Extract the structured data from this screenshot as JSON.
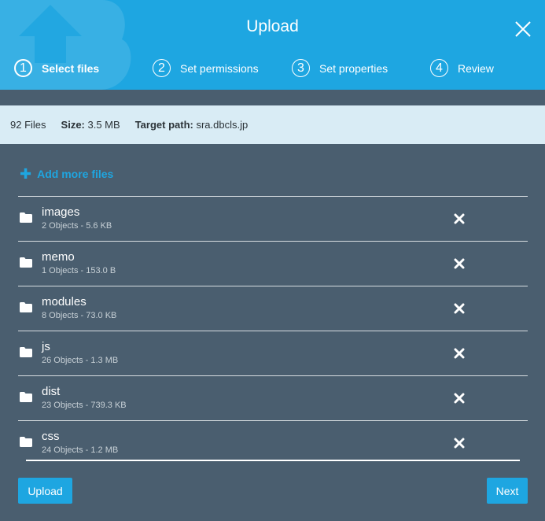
{
  "header": {
    "title": "Upload",
    "steps": [
      {
        "number": "1",
        "label": "Select files",
        "active": true
      },
      {
        "number": "2",
        "label": "Set permissions",
        "active": false
      },
      {
        "number": "3",
        "label": "Set properties",
        "active": false
      },
      {
        "number": "4",
        "label": "Review",
        "active": false
      }
    ]
  },
  "summary": {
    "files": "92 Files",
    "size_label": "Size:",
    "size_value": "3.5 MB",
    "target_label": "Target path:",
    "target_value": "sra.dbcls.jp"
  },
  "add_more_label": "Add more files",
  "folders": [
    {
      "name": "images",
      "meta": "2 Objects - 5.6 KB"
    },
    {
      "name": "memo",
      "meta": "1 Objects - 153.0 B"
    },
    {
      "name": "modules",
      "meta": "8 Objects - 73.0 KB"
    },
    {
      "name": "js",
      "meta": "26 Objects - 1.3 MB"
    },
    {
      "name": "dist",
      "meta": "23 Objects - 739.3 KB"
    },
    {
      "name": "css",
      "meta": "24 Objects - 1.2 MB"
    }
  ],
  "buttons": {
    "upload": "Upload",
    "next": "Next"
  },
  "icons": {
    "folder": "folder-icon",
    "remove": "close-x-icon",
    "close": "close-icon",
    "add": "plus-icon"
  },
  "colors": {
    "accent": "#1ea6e1",
    "background": "#4a5e6f",
    "summary_bg": "#d9ecf5"
  }
}
